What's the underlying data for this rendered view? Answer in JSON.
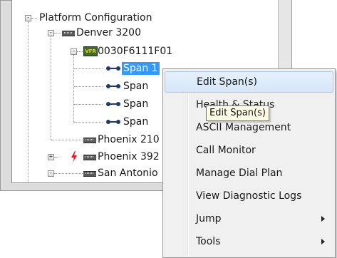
{
  "tree": {
    "root": {
      "label": "Platform Configuration",
      "expander": "-"
    },
    "nodes": [
      {
        "label": "Denver 3200",
        "expander": "-",
        "icon": "device-icon"
      },
      {
        "label": "0030F6111F01",
        "expander": "-",
        "icon": "board-icon",
        "badge": "VFR"
      },
      {
        "label": "Span 1",
        "icon": "span-icon",
        "selected": true
      },
      {
        "label": "Span",
        "icon": "span-icon"
      },
      {
        "label": "Span",
        "icon": "span-icon"
      },
      {
        "label": "Span",
        "icon": "span-icon"
      },
      {
        "label": "Phoenix 210",
        "icon": "device-icon"
      },
      {
        "label": "Phoenix 392",
        "expander": "+",
        "icon": "device-icon",
        "alert": "lightning-icon"
      },
      {
        "label": "San Antonio",
        "expander": "-",
        "icon": "device-icon"
      }
    ]
  },
  "context_menu": {
    "items": [
      {
        "label": "Edit Span(s)",
        "hover": true
      },
      {
        "label": "Health & Status"
      },
      {
        "label": "ASCII Management"
      },
      {
        "label": "Call Monitor"
      },
      {
        "label": "Manage Dial Plan"
      },
      {
        "label": "View Diagnostic Logs"
      },
      {
        "label": "Jump",
        "submenu": true
      },
      {
        "label": "Tools",
        "submenu": true
      }
    ]
  },
  "tooltip": {
    "text": "Edit Span(s)"
  },
  "colors": {
    "selection": "#3399ff",
    "menu_hover": "#d6e6f9",
    "alert": "#e8131b"
  }
}
